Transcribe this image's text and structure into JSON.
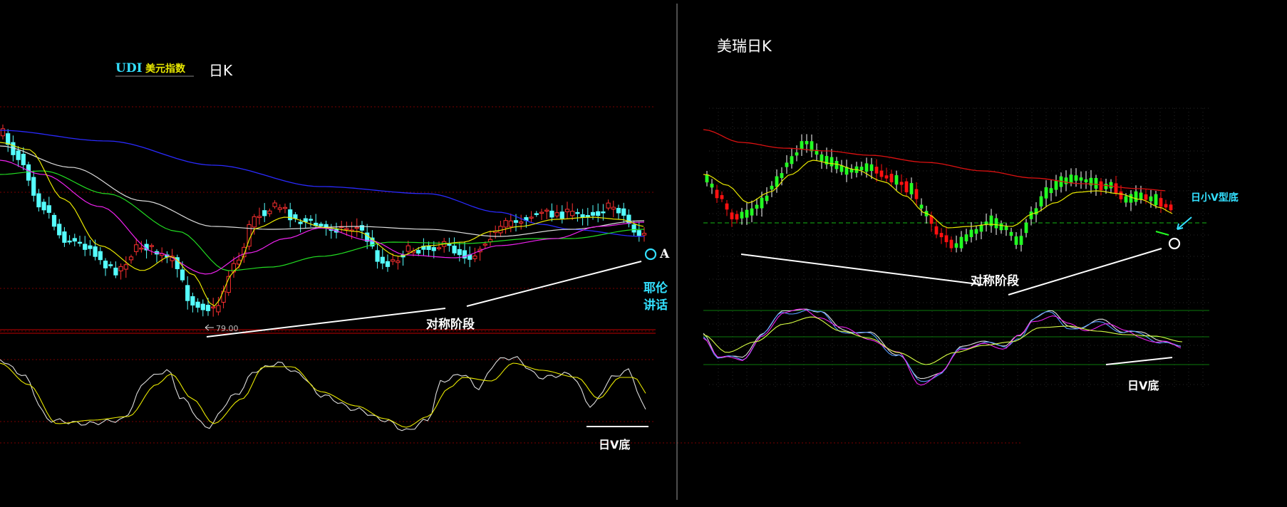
{
  "colors": {
    "background": "#000000",
    "candle_up": "#ff3030",
    "candle_down": "#55ffff",
    "bull_bar": "#22ff22",
    "bear_bar": "#ff1111",
    "ma_blue": "#2a2aff",
    "ma_white": "#dddddd",
    "ma_green": "#22dd22",
    "ma_magenta": "#ee22ee",
    "ma_yellow": "#e8e800",
    "annotation_white": "#ffffff",
    "annotation_cyan": "#33e0ff",
    "grid_red": "#7a0000",
    "grid_green": "#0d7a0d",
    "divider": "#9a9a9a"
  },
  "left_panel": {
    "title_udi": "UDI",
    "title_index": "美元指数",
    "title_period": "日K",
    "low_price_label": "79.00",
    "symmetry_label": "对称阶段",
    "point_label": "A",
    "note_line1": "耶伦",
    "note_line2": "讲话",
    "oscillator_label": "日V底"
  },
  "right_panel": {
    "title": "美瑞日K",
    "symmetry_label": "对称阶段",
    "v_bottom_label": "日小V型底",
    "oscillator_label": "日V底"
  },
  "chart_data": [
    {
      "type": "candlestick",
      "title": "UDI 美元指数 日K",
      "annotated_low": 79.0,
      "overlays": [
        "moving averages (blue, white, green, magenta, yellow)"
      ],
      "annotations": [
        "对称阶段",
        "A",
        "耶伦讲话"
      ],
      "indicator": {
        "type": "line",
        "series_count": 2,
        "label": "日V底"
      }
    },
    {
      "type": "candlestick",
      "title": "美瑞日K",
      "overlays": [
        "moving average (red)",
        "moving average (yellow)"
      ],
      "annotations": [
        "对称阶段",
        "日小V型底"
      ],
      "indicator": {
        "type": "line",
        "series_count": 4,
        "label": "日V底"
      }
    }
  ]
}
